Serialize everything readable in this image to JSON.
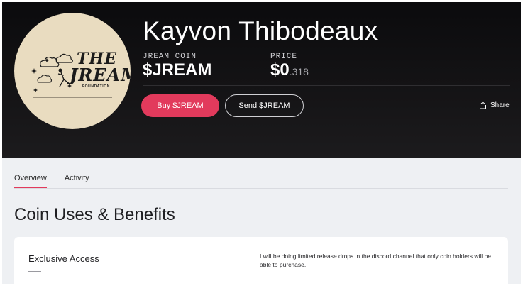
{
  "profile": {
    "name": "Kayvon Thibodeaux",
    "avatar_logo_line1": "THE",
    "avatar_logo_line2": "JREAM",
    "avatar_logo_sub": "FOUNDATION"
  },
  "coin": {
    "label": "JREAM COIN",
    "ticker": "$JREAM"
  },
  "price": {
    "label": "PRICE",
    "whole": "$0",
    "fraction": ".318"
  },
  "actions": {
    "buy_label": "Buy $JREAM",
    "send_label": "Send $JREAM",
    "share_label": "Share"
  },
  "tabs": [
    {
      "label": "Overview",
      "active": true
    },
    {
      "label": "Activity",
      "active": false
    }
  ],
  "section": {
    "title": "Coin Uses & Benefits"
  },
  "benefits": [
    {
      "title": "Exclusive Access",
      "description": "I will be doing limited release drops in the discord channel that only coin holders will be able to purchase."
    }
  ],
  "colors": {
    "accent": "#e23a5c",
    "hero_bg": "#0b0b0d",
    "page_bg": "#eef0f3"
  },
  "icons": {
    "share": "share-icon"
  }
}
